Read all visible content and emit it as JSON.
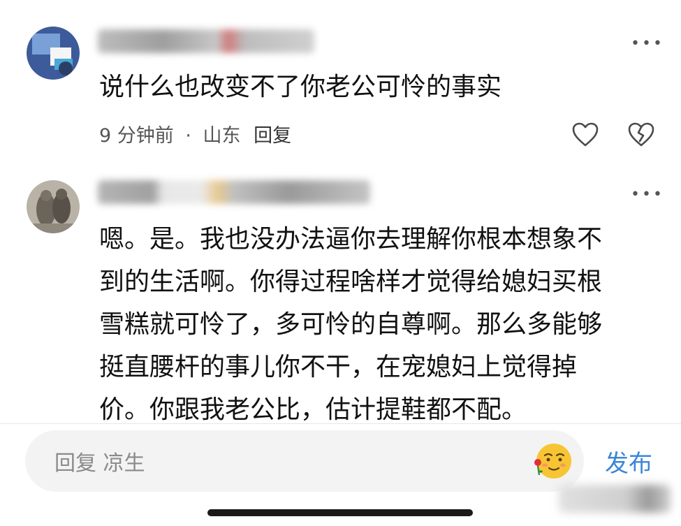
{
  "comments": [
    {
      "text": "说什么也改变不了你老公可怜的事实",
      "time": "9 分钟前",
      "location": "山东",
      "reply_label": "回复",
      "separator": "·"
    },
    {
      "text_lines": [
        "嗯。是。我也没办法逼你去理解你根本想象不",
        "到的生活啊。你得过程啥样才觉得给媳妇买根",
        "雪糕就可怜了，多可怜的自尊啊。那么多能够",
        "挺直腰杆的事儿你不干，在宠媳妇上觉得掉",
        "价。你跟我老公比，估计提鞋都不配。"
      ]
    }
  ],
  "reply_bar": {
    "placeholder": "回复 凉生",
    "send_label": "发布"
  },
  "icons": {
    "more": "more-dots-icon",
    "like": "heart-icon",
    "dislike": "broken-heart-icon",
    "emoji": "emoji-icon"
  },
  "colors": {
    "send": "#3b86d9",
    "meta": "#555555",
    "input_bg": "#f3f3f3"
  }
}
